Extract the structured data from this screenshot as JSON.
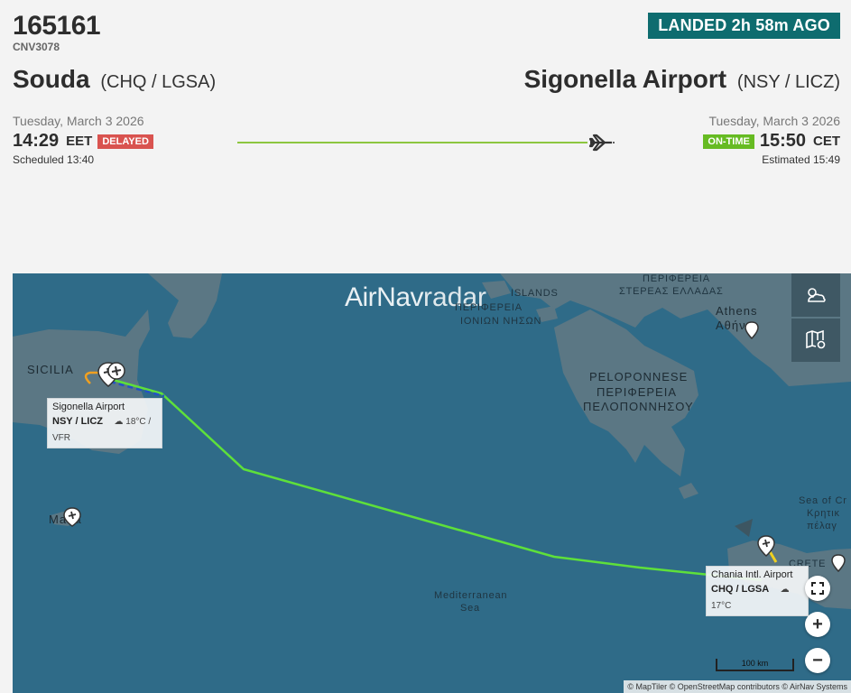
{
  "flight": {
    "number": "165161",
    "callsign": "CNV3078",
    "status": "LANDED 2h 58m AGO"
  },
  "origin": {
    "name": "Souda",
    "codes": "(CHQ / LGSA)",
    "date": "Tuesday, March 3 2026",
    "time": "14:29",
    "tz": "EET",
    "badge": "DELAYED",
    "scheduled": "Scheduled 13:40"
  },
  "destination": {
    "name": "Sigonella Airport",
    "codes": "(NSY / LICZ)",
    "date": "Tuesday, March 3 2026",
    "time": "15:50",
    "tz": "CET",
    "badge": "ON-TIME",
    "estimated": "Estimated 15:49"
  },
  "map": {
    "brand_a": "AirNav",
    "brand_b": "radar",
    "labels": {
      "ionian_1": "ISLANDS",
      "ionian_2": "ΙΟΝΙΩΝ ΝΗΣΩΝ",
      "sterea_1": "ΠΕΡΙΦΕΡΕΙΑ",
      "sterea_2": "ΣΤΕΡΕΑΣ ΕΛΛΑΔΑΣ",
      "ionian_region": "ΠΕΡΙΦΕΡΕΙΑ",
      "athens_1": "Athens",
      "athens_2": "Αθήνα",
      "sicilia": "SICILIA",
      "pelo_1": "PELOPONNESE",
      "pelo_2": "ΠΕΡΙΦΕΡΕΙΑ",
      "pelo_3": "ΠΕΛΟΠΟΝΝΗΣΟΥ",
      "malta": "Malta",
      "med_1": "Mediterranean",
      "med_2": "Sea",
      "crete_sea_1": "Sea of Cr",
      "crete_sea_2": "Κρητικ",
      "crete_sea_3": "πέλαγ",
      "crete": "CRETE"
    },
    "dest_airport": {
      "name": "Sigonella Airport",
      "codes": "NSY / LICZ",
      "weather": "18°C / VFR"
    },
    "orig_airport": {
      "name": "Chania Intl. Airport",
      "codes": "CHQ / LGSA",
      "weather": "17°C"
    },
    "scale": "100 km",
    "attribution": "© MapTiler © OpenStreetMap contributors © AirNav Systems",
    "zoom_in": "+",
    "zoom_out": "−"
  },
  "colors": {
    "status": "#0e6c6f",
    "delayed": "#d9534f",
    "ontime": "#66bb22",
    "track": "#5ee03a",
    "sea": "#2f6b88",
    "land": "#5b7784"
  },
  "icons": [
    "plane-icon",
    "weather-icon",
    "map-settings-icon",
    "fullscreen-icon",
    "airport-pin-icon",
    "cloud-icon"
  ]
}
